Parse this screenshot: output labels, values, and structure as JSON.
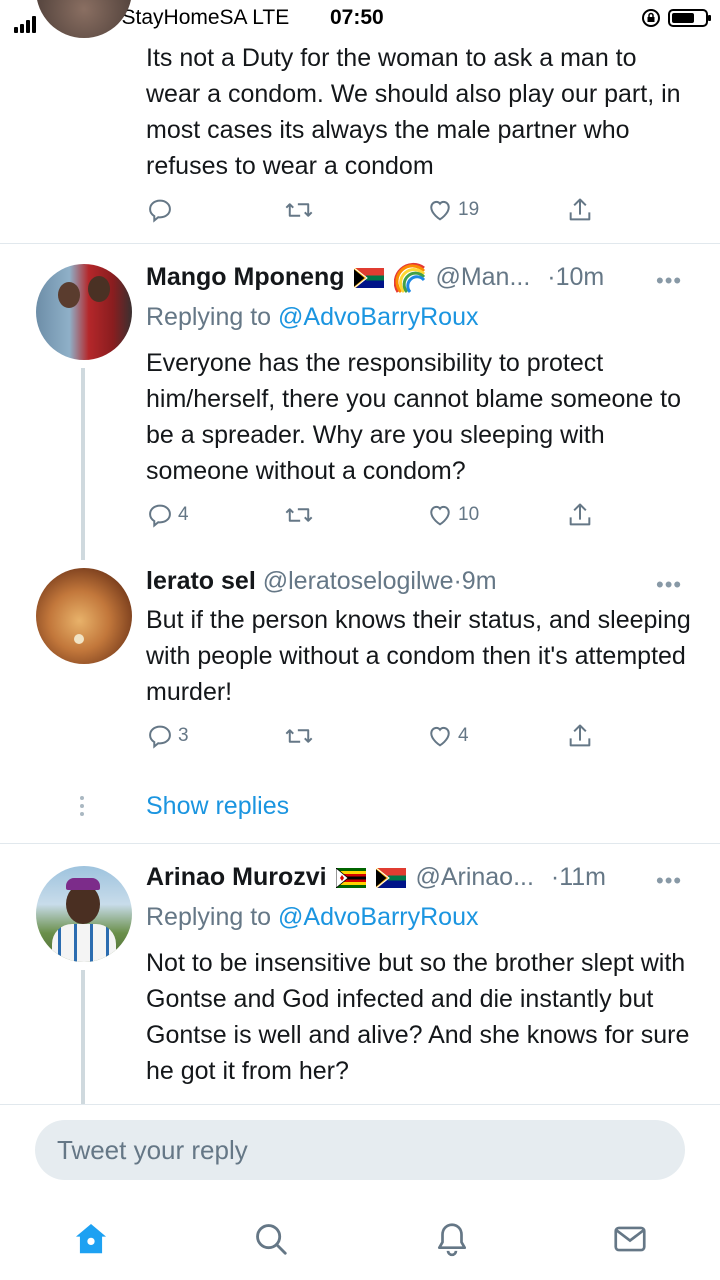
{
  "status_bar": {
    "carrier": "Telkom-StayHomeSA",
    "network": "LTE",
    "time": "07:50"
  },
  "tweets": [
    {
      "text": "Its not a Duty for the woman to ask a man to wear a condom. We should also play our part, in most cases its always the male partner who refuses to wear a condom",
      "reply_count": "",
      "like_count": "19"
    },
    {
      "name": "Mango Mponeng",
      "handle": "@Man...",
      "time": "·10m",
      "replying_prefix": "Replying to",
      "replying_to": "@AdvoBarryRoux",
      "text": "Everyone has the responsibility to protect him/herself, there you cannot blame someone to be a spreader. Why are you sleeping with someone without a condom?",
      "reply_count": "4",
      "like_count": "10"
    },
    {
      "name": "lerato sel",
      "handle": "@leratoselogilwe",
      "time": "·9m",
      "text": "But if the person knows their status, and sleeping with people without a condom then it's attempted murder!",
      "reply_count": "3",
      "like_count": "4"
    },
    {
      "name": "Arinao Murozvi",
      "handle": "@Arinao...",
      "time": "·11m",
      "replying_prefix": "Replying to",
      "replying_to": "@AdvoBarryRoux",
      "text": "Not to be insensitive but so the brother slept with Gontse and God infected and die instantly but Gontse is well and alive? And she knows for sure he got it from her?"
    }
  ],
  "show_replies_label": "Show replies",
  "reply_box": {
    "placeholder": "Tweet your reply"
  },
  "colors": {
    "accent": "#1b95e0",
    "muted": "#657786",
    "text": "#14171a",
    "tab_active": "#1da1f2"
  },
  "tab_bar": {
    "tabs": [
      "home-icon",
      "search-icon",
      "notifications-icon",
      "messages-icon"
    ],
    "active": "home-icon"
  }
}
